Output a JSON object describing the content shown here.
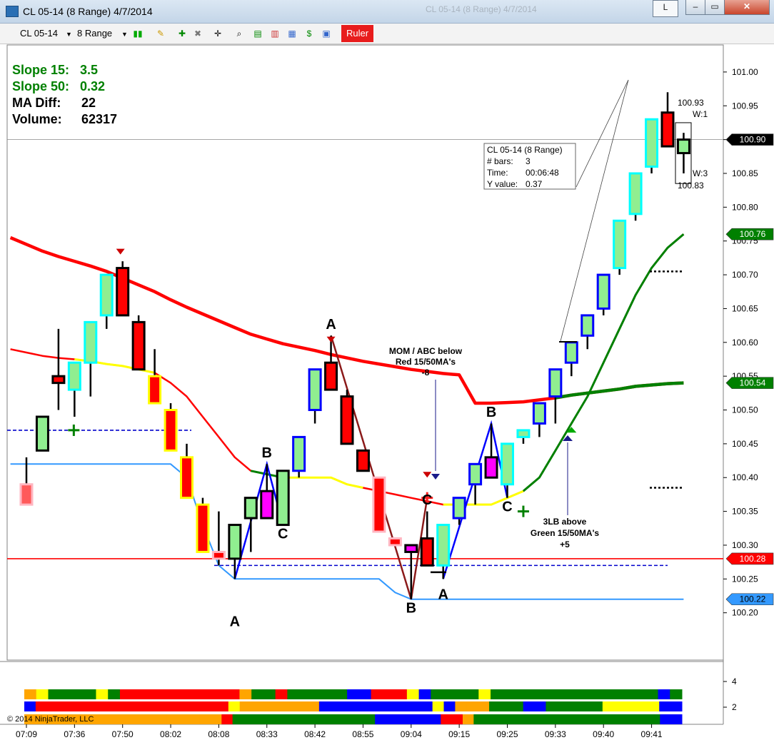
{
  "window": {
    "title": "CL 05-14 (8 Range)  4/7/2014",
    "ghost_title": "CL 05-14 (8 Range)  4/7/2014",
    "button_l": "L"
  },
  "toolbar": {
    "instrument": "CL 05-14",
    "period": "8 Range",
    "ruler_label": "Ruler"
  },
  "stats": {
    "slope15_label": "Slope 15:",
    "slope15_value": "3.5",
    "slope50_label": "Slope 50:",
    "slope50_value": "0.32",
    "madiff_label": "MA Diff:",
    "madiff_value": "22",
    "volume_label": "Volume:",
    "volume_value": "62317"
  },
  "colors": {
    "bull_body": "#90ee90",
    "bear_body": "#ff0000",
    "magenta_body": "#ff00ff",
    "outline_black": "#000000",
    "outline_blue": "#0000ff",
    "outline_cyan": "#00ffff",
    "outline_yellow": "#ffff00",
    "outline_pink": "#ffb6c1",
    "ma_red": "#ff0000",
    "ma_green": "#008000",
    "ma_yellow": "#ffff00",
    "env_blue": "#3399ff",
    "dash_blue": "#0000cc",
    "abc_blue": "#0000ff",
    "abc_brown": "#8b1a1a"
  },
  "chart_data": {
    "type": "candlestick",
    "ylim": [
      100.13,
      101.04
    ],
    "yticks": [
      101.0,
      100.95,
      100.9,
      100.85,
      100.8,
      100.75,
      100.7,
      100.65,
      100.6,
      100.55,
      100.5,
      100.45,
      100.4,
      100.35,
      100.3,
      100.25,
      100.2
    ],
    "xticks": [
      {
        "label": "07:09",
        "bar": 0
      },
      {
        "label": "07:36",
        "bar": 3
      },
      {
        "label": "07:50",
        "bar": 6
      },
      {
        "label": "08:02",
        "bar": 9
      },
      {
        "label": "08:08",
        "bar": 12
      },
      {
        "label": "08:33",
        "bar": 15
      },
      {
        "label": "08:42",
        "bar": 18
      },
      {
        "label": "08:55",
        "bar": 21
      },
      {
        "label": "09:04",
        "bar": 24
      },
      {
        "label": "09:15",
        "bar": 27
      },
      {
        "label": "09:25",
        "bar": 30
      },
      {
        "label": "09:33",
        "bar": 33
      },
      {
        "label": "09:40",
        "bar": 36
      },
      {
        "label": "09:41",
        "bar": 39
      }
    ],
    "bars": [
      {
        "o": 100.39,
        "h": 100.43,
        "l": 100.37,
        "c": 100.36,
        "fill": "pink",
        "edge": "pink"
      },
      {
        "o": 100.44,
        "h": 100.45,
        "l": 100.46,
        "c": 100.49,
        "fill": "green",
        "edge": "black"
      },
      {
        "o": 100.54,
        "h": 100.62,
        "l": 100.5,
        "c": 100.55,
        "fill": "red",
        "edge": "black"
      },
      {
        "o": 100.53,
        "h": 100.57,
        "l": 100.49,
        "c": 100.57,
        "fill": "green",
        "edge": "cyan"
      },
      {
        "o": 100.57,
        "h": 100.63,
        "l": 100.52,
        "c": 100.63,
        "fill": "green",
        "edge": "cyan"
      },
      {
        "o": 100.64,
        "h": 100.7,
        "l": 100.62,
        "c": 100.7,
        "fill": "green",
        "edge": "cyan"
      },
      {
        "o": 100.71,
        "h": 100.72,
        "l": 100.64,
        "c": 100.64,
        "fill": "red",
        "edge": "black"
      },
      {
        "o": 100.63,
        "h": 100.64,
        "l": 100.56,
        "c": 100.56,
        "fill": "red",
        "edge": "black"
      },
      {
        "o": 100.55,
        "h": 100.59,
        "l": 100.51,
        "c": 100.51,
        "fill": "red",
        "edge": "yellow"
      },
      {
        "o": 100.5,
        "h": 100.51,
        "l": 100.44,
        "c": 100.44,
        "fill": "red",
        "edge": "yellow"
      },
      {
        "o": 100.43,
        "h": 100.45,
        "l": 100.37,
        "c": 100.37,
        "fill": "red",
        "edge": "yellow"
      },
      {
        "o": 100.36,
        "h": 100.37,
        "l": 100.29,
        "c": 100.29,
        "fill": "red",
        "edge": "yellow"
      },
      {
        "o": 100.29,
        "h": 100.35,
        "l": 100.27,
        "c": 100.28,
        "fill": "red",
        "edge": "pink"
      },
      {
        "o": 100.28,
        "h": 100.33,
        "l": 100.25,
        "c": 100.33,
        "fill": "green",
        "edge": "black"
      },
      {
        "o": 100.34,
        "h": 100.37,
        "l": 100.29,
        "c": 100.37,
        "fill": "green",
        "edge": "black"
      },
      {
        "o": 100.34,
        "h": 100.42,
        "l": 100.34,
        "c": 100.38,
        "fill": "magenta",
        "edge": "black"
      },
      {
        "o": 100.33,
        "h": 100.41,
        "l": 100.33,
        "c": 100.41,
        "fill": "green",
        "edge": "black"
      },
      {
        "o": 100.41,
        "h": 100.46,
        "l": 100.4,
        "c": 100.46,
        "fill": "green",
        "edge": "blue"
      },
      {
        "o": 100.5,
        "h": 100.56,
        "l": 100.48,
        "c": 100.56,
        "fill": "green",
        "edge": "blue"
      },
      {
        "o": 100.57,
        "h": 100.61,
        "l": 100.53,
        "c": 100.53,
        "fill": "red",
        "edge": "black"
      },
      {
        "o": 100.52,
        "h": 100.53,
        "l": 100.45,
        "c": 100.45,
        "fill": "red",
        "edge": "black"
      },
      {
        "o": 100.44,
        "h": 100.44,
        "l": 100.41,
        "c": 100.41,
        "fill": "red",
        "edge": "black"
      },
      {
        "o": 100.4,
        "h": 100.4,
        "l": 100.32,
        "c": 100.32,
        "fill": "red",
        "edge": "pink"
      },
      {
        "o": 100.31,
        "h": 100.31,
        "l": 100.3,
        "c": 100.3,
        "fill": "red",
        "edge": "pink"
      },
      {
        "o": 100.3,
        "h": 100.3,
        "l": 100.22,
        "c": 100.29,
        "fill": "magenta",
        "edge": "black"
      },
      {
        "o": 100.31,
        "h": 100.35,
        "l": 100.27,
        "c": 100.27,
        "fill": "red",
        "edge": "black"
      },
      {
        "o": 100.27,
        "h": 100.33,
        "l": 100.25,
        "c": 100.33,
        "fill": "green",
        "edge": "cyan"
      },
      {
        "o": 100.34,
        "h": 100.37,
        "l": 100.33,
        "c": 100.37,
        "fill": "green",
        "edge": "blue"
      },
      {
        "o": 100.39,
        "h": 100.42,
        "l": 100.36,
        "c": 100.42,
        "fill": "green",
        "edge": "blue"
      },
      {
        "o": 100.43,
        "h": 100.48,
        "l": 100.4,
        "c": 100.4,
        "fill": "magenta",
        "edge": "black"
      },
      {
        "o": 100.39,
        "h": 100.45,
        "l": 100.37,
        "c": 100.45,
        "fill": "green",
        "edge": "cyan"
      },
      {
        "o": 100.46,
        "h": 100.47,
        "l": 100.45,
        "c": 100.47,
        "fill": "green",
        "edge": "cyan"
      },
      {
        "o": 100.48,
        "h": 100.51,
        "l": 100.46,
        "c": 100.51,
        "fill": "green",
        "edge": "blue"
      },
      {
        "o": 100.52,
        "h": 100.56,
        "l": 100.48,
        "c": 100.56,
        "fill": "green",
        "edge": "blue"
      },
      {
        "o": 100.57,
        "h": 100.6,
        "l": 100.55,
        "c": 100.6,
        "fill": "green",
        "edge": "blue"
      },
      {
        "o": 100.61,
        "h": 100.64,
        "l": 100.59,
        "c": 100.64,
        "fill": "green",
        "edge": "blue"
      },
      {
        "o": 100.65,
        "h": 100.7,
        "l": 100.64,
        "c": 100.7,
        "fill": "green",
        "edge": "blue"
      },
      {
        "o": 100.71,
        "h": 100.78,
        "l": 100.7,
        "c": 100.78,
        "fill": "green",
        "edge": "cyan"
      },
      {
        "o": 100.79,
        "h": 100.85,
        "l": 100.78,
        "c": 100.85,
        "fill": "green",
        "edge": "cyan"
      },
      {
        "o": 100.86,
        "h": 100.93,
        "l": 100.85,
        "c": 100.93,
        "fill": "green",
        "edge": "cyan"
      },
      {
        "o": 100.94,
        "h": 100.97,
        "l": 100.89,
        "c": 100.89,
        "fill": "red",
        "edge": "black"
      },
      {
        "o": 100.9,
        "h": 100.91,
        "l": 100.85,
        "c": 100.88,
        "fill": "green",
        "edge": "black"
      }
    ],
    "series": [
      {
        "line": "ma15",
        "values": [
          100.59,
          100.585,
          100.58,
          100.577,
          100.575,
          100.572,
          100.568,
          100.565,
          100.56,
          100.555,
          100.54,
          100.52,
          100.49,
          100.46,
          100.43,
          100.41,
          100.405,
          100.4,
          100.4,
          100.4,
          100.4,
          100.39,
          100.385,
          100.38,
          100.375,
          100.37,
          100.365,
          100.36,
          100.36,
          100.36,
          100.36,
          100.37,
          100.38,
          100.4,
          100.44,
          100.48,
          100.52,
          100.57,
          100.62,
          100.67,
          100.71,
          100.74,
          100.76
        ]
      },
      {
        "line": "ma50",
        "values": [
          100.755,
          100.745,
          100.735,
          100.727,
          100.72,
          100.713,
          100.705,
          100.695,
          100.685,
          100.675,
          100.663,
          100.652,
          100.642,
          100.632,
          100.622,
          100.612,
          100.605,
          100.598,
          100.593,
          100.588,
          100.582,
          100.577,
          100.572,
          100.568,
          100.564,
          100.56,
          100.557,
          100.554,
          100.552,
          100.51,
          100.51,
          100.511,
          100.512,
          100.515,
          100.518,
          100.522,
          100.525,
          100.528,
          100.531,
          100.535,
          100.537,
          100.539,
          100.54
        ]
      },
      {
        "line": "envelope",
        "values": [
          100.42,
          100.42,
          100.42,
          100.42,
          100.42,
          100.42,
          100.42,
          100.42,
          100.42,
          100.42,
          100.42,
          100.4,
          100.33,
          100.27,
          100.25,
          100.25,
          100.25,
          100.25,
          100.25,
          100.25,
          100.25,
          100.25,
          100.25,
          100.25,
          100.23,
          100.22,
          100.22,
          100.22,
          100.22,
          100.22,
          100.22,
          100.22,
          100.22,
          100.22,
          100.22,
          100.22,
          100.22,
          100.22,
          100.22,
          100.22,
          100.22,
          100.22,
          100.22
        ]
      }
    ],
    "price_tags": [
      {
        "label": "100.90",
        "value": 100.9,
        "color": "#000000",
        "text": "#ffffff"
      },
      {
        "label": "100.76",
        "value": 100.76,
        "color": "#008000",
        "text": "#ffffff"
      },
      {
        "label": "100.54",
        "value": 100.54,
        "color": "#008000",
        "text": "#ffffff"
      },
      {
        "label": "100.28",
        "value": 100.28,
        "color": "#ff0000",
        "text": "#ffffff"
      },
      {
        "label": "100.22",
        "value": 100.22,
        "color": "#3399ff",
        "text": "#000000"
      }
    ],
    "hlines": [
      {
        "value": 100.28,
        "color": "#ff0000",
        "style": "solid"
      },
      {
        "value": 100.47,
        "color": "#0000cc",
        "style": "dashed"
      },
      {
        "value": 100.27,
        "color": "#0000cc",
        "style": "dashed"
      },
      {
        "value": 100.9,
        "color": "#888888",
        "style": "solid"
      }
    ],
    "abc_labels": [
      {
        "text": "A",
        "bar": 13,
        "value": 100.18
      },
      {
        "text": "B",
        "bar": 15,
        "value": 100.43
      },
      {
        "text": "C",
        "bar": 16,
        "value": 100.31
      },
      {
        "text": "A",
        "bar": 19,
        "value": 100.62
      },
      {
        "text": "B",
        "bar": 24,
        "value": 100.2
      },
      {
        "text": "C",
        "bar": 25,
        "value": 100.36
      },
      {
        "text": "A",
        "bar": 26,
        "value": 100.22
      },
      {
        "text": "B",
        "bar": 29,
        "value": 100.49
      },
      {
        "text": "C",
        "bar": 30,
        "value": 100.35
      }
    ],
    "annotations": {
      "mom_line1": "MOM / ABC below",
      "mom_line2": "Red 15/50MA's",
      "mom_line3": "-8",
      "lb_line1": "3LB above",
      "lb_line2": "Green 15/50MA's",
      "lb_line3": "+5",
      "ruler_high": "100.93",
      "ruler_low": "100.83",
      "ruler_w1": "W:1",
      "ruler_w3": "W:3"
    },
    "tooltip": {
      "title": "CL 05-14 (8 Range)",
      "bars_label": "# bars:",
      "bars_value": "3",
      "time_label": "Time:",
      "time_value": "00:06:48",
      "yval_label": "Y value:",
      "yval_value": "0.37"
    },
    "lower_panel": {
      "yticks": [
        "4",
        "2"
      ],
      "copyright": "© 2014 NinjaTrader, LLC"
    }
  }
}
